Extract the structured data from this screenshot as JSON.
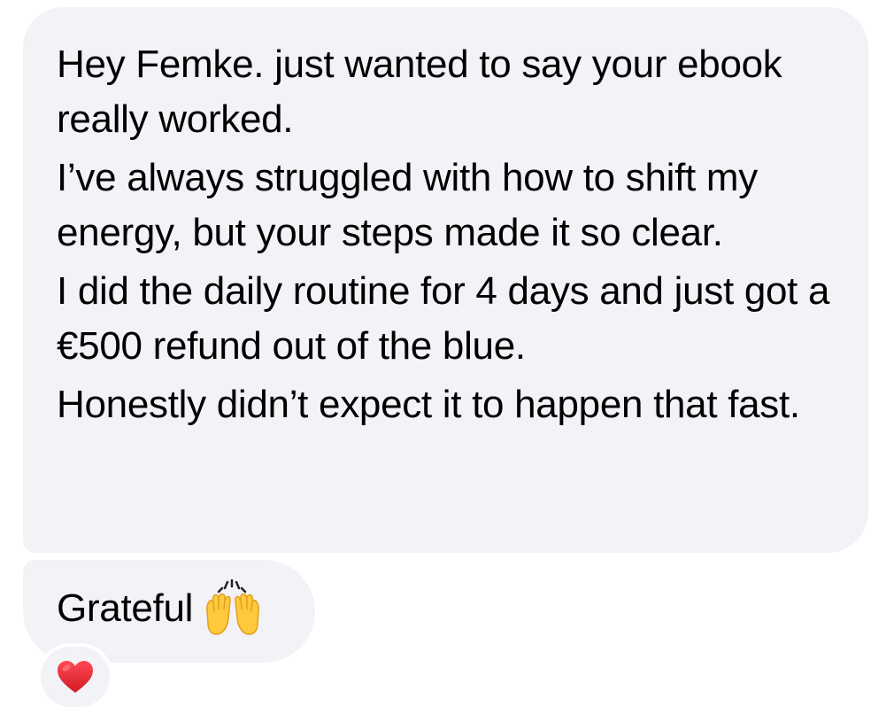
{
  "messages": [
    {
      "paragraphs": [
        "Hey Femke. just wanted to say your ebook really worked.",
        "I’ve always struggled with how to shift my energy, but your steps made it so clear.",
        "I did the daily routine for 4 days and just got a €500 refund out of the blue.",
        "Honestly didn’t expect it to happen that fast."
      ]
    },
    {
      "text": "Grateful",
      "emoji": "raising-hands-icon"
    }
  ],
  "reaction": {
    "emoji": "red-heart-icon"
  },
  "colors": {
    "bubble_background": "#f2f2f7",
    "text": "#000000",
    "heart": "#e0242f",
    "hands": "#ffc83d"
  }
}
